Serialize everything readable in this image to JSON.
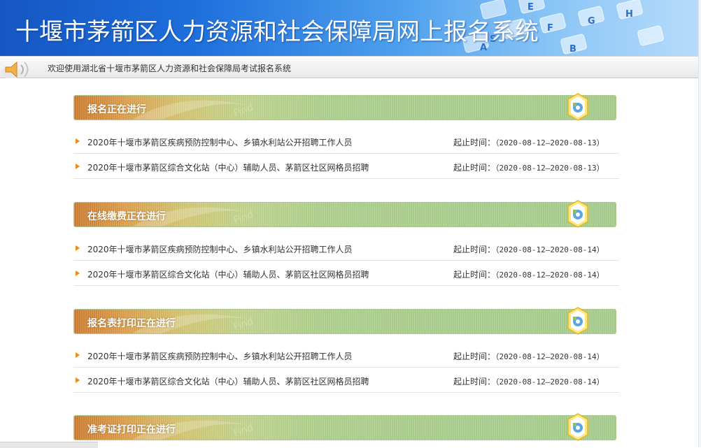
{
  "header": {
    "title": "十堰市茅箭区人力资源和社会保障局网上报名系统",
    "welcome_text": "欢迎使用湖北省十堰市茅箭区人力资源和社会保障局考试报名系统"
  },
  "colors": {
    "banner_blue": "#1e6fdc",
    "section_green": "#a9cc89",
    "section_orange": "#c97a2e",
    "arrow_orange": "#f08a1c"
  },
  "icons": {
    "row_bullet": "arrow-right-icon",
    "section_badge": "gear-hexagon-icon",
    "welcome": "speaker-icon"
  },
  "sections": [
    {
      "title": "报名正在进行",
      "items": [
        {
          "name": "2020年十堰市茅箭区疾病预防控制中心、乡镇水利站公开招聘工作人员",
          "date_label": "起止时间：",
          "date_range": "（2020-08-12—2020-08-13）"
        },
        {
          "name": "2020年十堰市茅箭区综合文化站（中心）辅助人员、茅箭区社区网格员招聘",
          "date_label": "起止时间：",
          "date_range": "（2020-08-12—2020-08-13）"
        }
      ]
    },
    {
      "title": "在线缴费正在进行",
      "items": [
        {
          "name": "2020年十堰市茅箭区疾病预防控制中心、乡镇水利站公开招聘工作人员",
          "date_label": "起止时间：",
          "date_range": "（2020-08-12—2020-08-14）"
        },
        {
          "name": "2020年十堰市茅箭区综合文化站（中心）辅助人员、茅箭区社区网格员招聘",
          "date_label": "起止时间：",
          "date_range": "（2020-08-12—2020-08-14）"
        }
      ]
    },
    {
      "title": "报名表打印正在进行",
      "items": [
        {
          "name": "2020年十堰市茅箭区疾病预防控制中心、乡镇水利站公开招聘工作人员",
          "date_label": "起止时间：",
          "date_range": "（2020-08-12—2020-08-14）"
        },
        {
          "name": "2020年十堰市茅箭区综合文化站（中心）辅助人员、茅箭区社区网格员招聘",
          "date_label": "起止时间：",
          "date_range": "（2020-08-12—2020-08-14）"
        }
      ]
    },
    {
      "title": "准考证打印正在进行",
      "items": []
    }
  ]
}
